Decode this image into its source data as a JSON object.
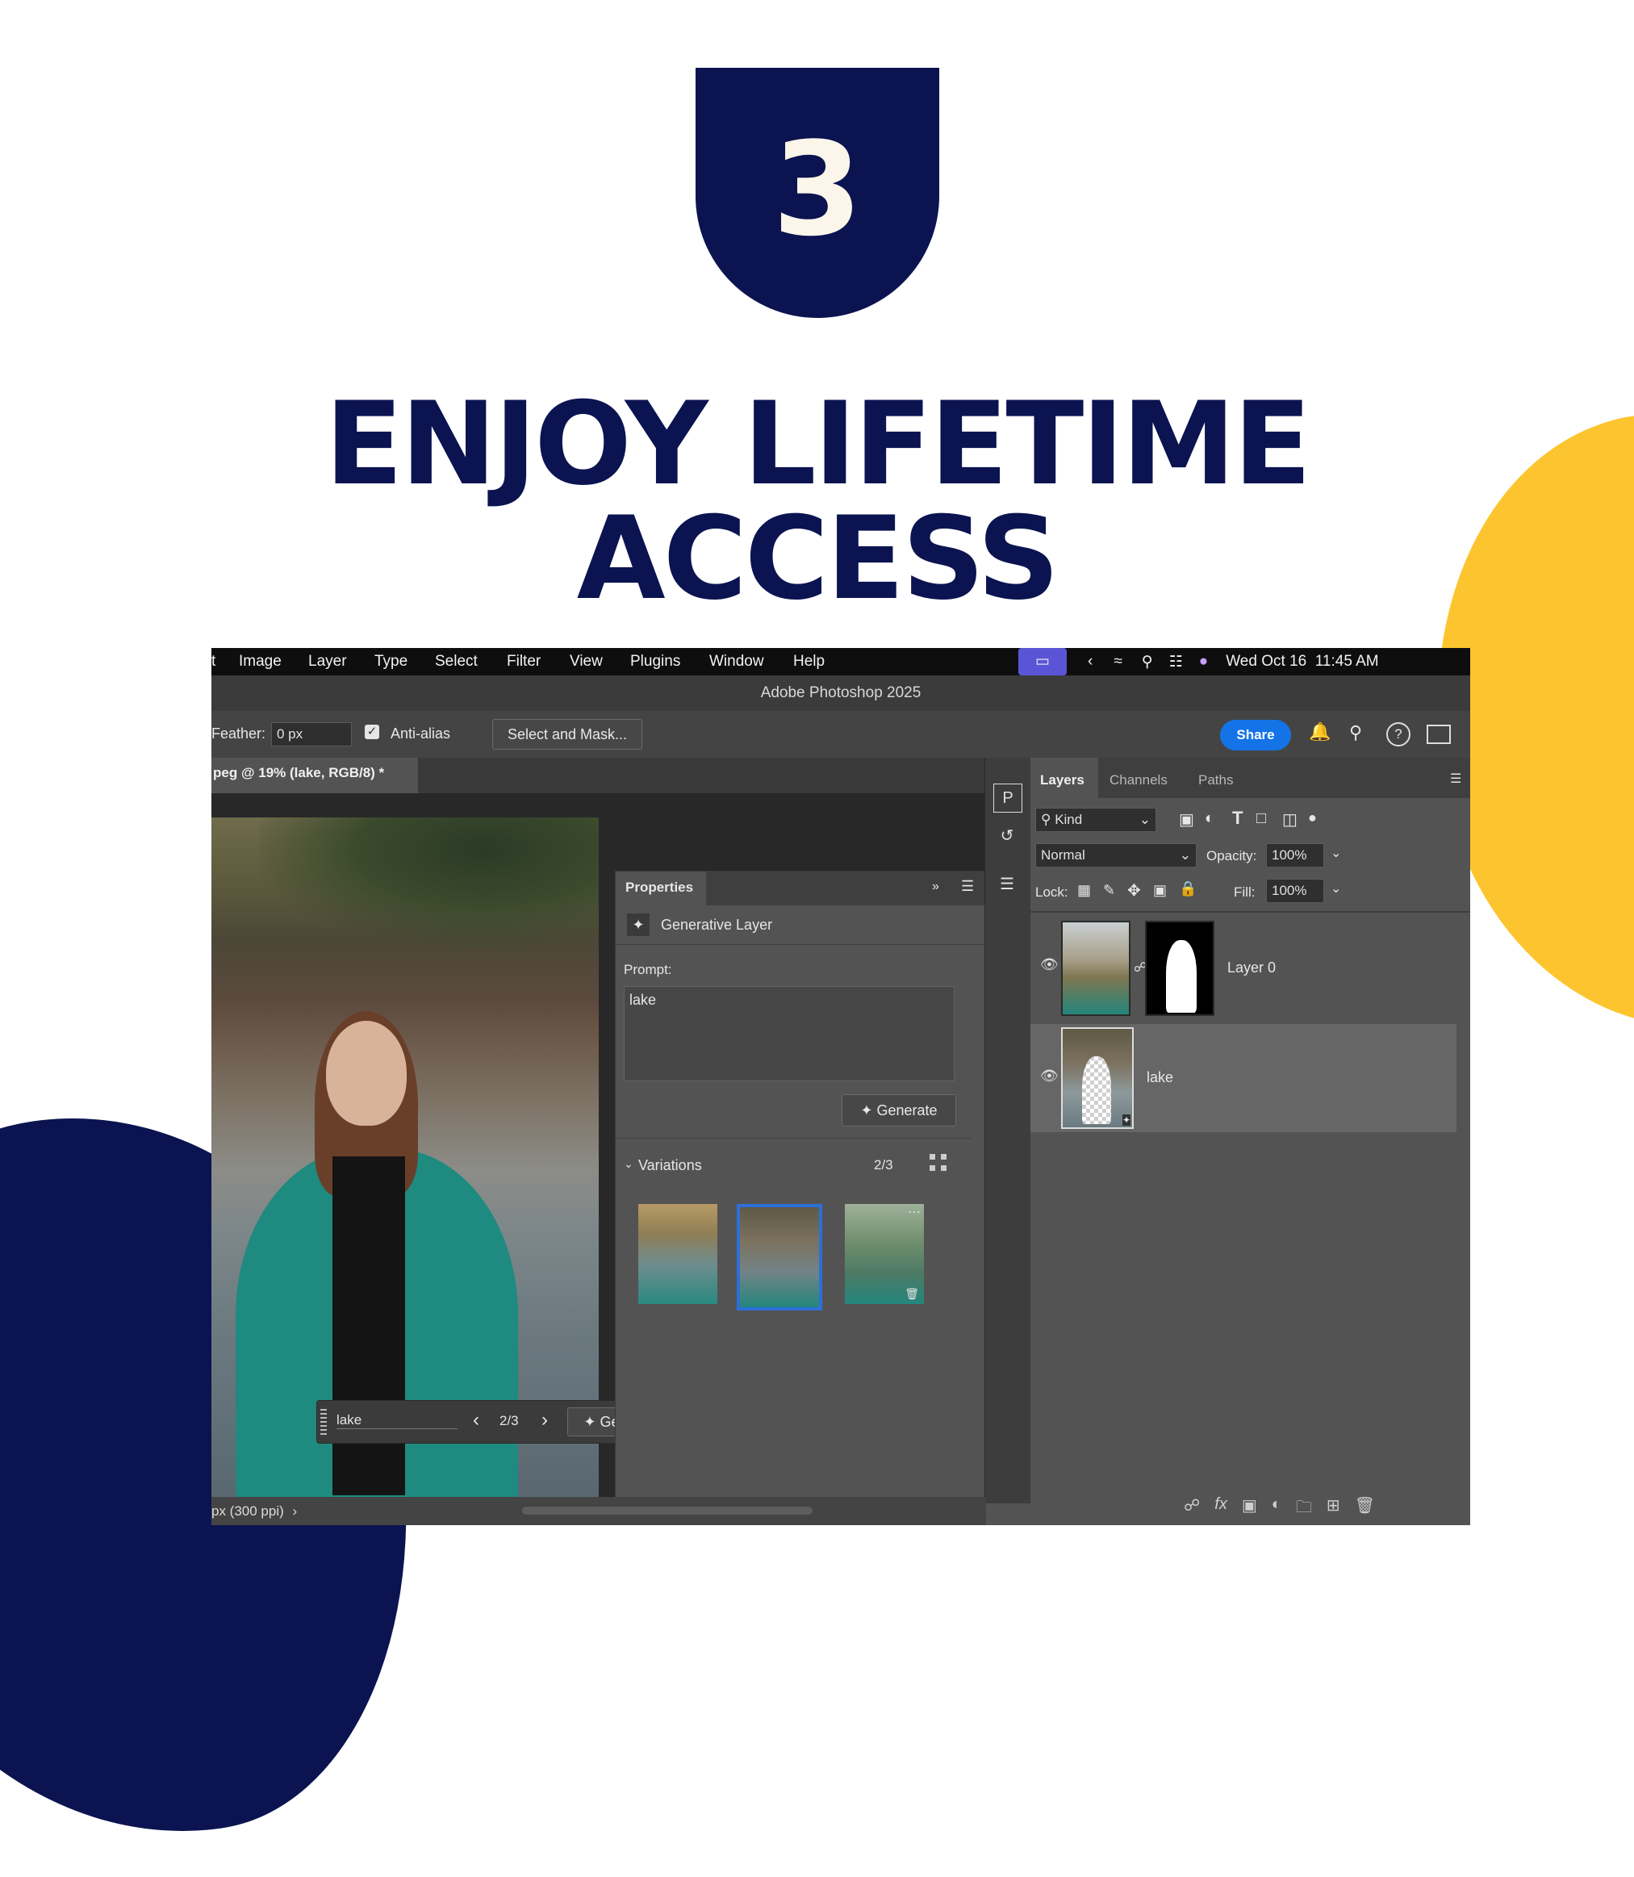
{
  "colors": {
    "navy": "#0b1450",
    "yellow": "#fcc52f",
    "cream": "#fbf5ea",
    "share_blue": "#1473e6"
  },
  "badge": {
    "number": "3"
  },
  "headline": {
    "line1": "ENJOY LIFETIME",
    "line2": "ACCESS"
  },
  "menubar": {
    "items": [
      "t",
      "Image",
      "Layer",
      "Type",
      "Select",
      "Filter",
      "View",
      "Plugins",
      "Window",
      "Help"
    ],
    "datetime": "Wed Oct 16  11:45 AM"
  },
  "app_title": "Adobe Photoshop 2025",
  "options": {
    "feather_label": "Feather:",
    "feather_value": "0 px",
    "antialias_label": "Anti-alias",
    "select_mask_label": "Select and Mask...",
    "share_label": "Share"
  },
  "document_tab": "peg @ 19% (lake, RGB/8) *",
  "status": {
    "text": "px (300 ppi)"
  },
  "floating_bar": {
    "prompt": "lake",
    "counter": "2/3",
    "generate_label": "Generate"
  },
  "properties": {
    "tab": "Properties",
    "layer_type": "Generative Layer",
    "prompt_label": "Prompt:",
    "prompt_value": "lake",
    "generate_label": "Generate",
    "variations_label": "Variations",
    "variations_count": "2/3",
    "selected_variation": 2
  },
  "layers_panel": {
    "tabs": [
      "Layers",
      "Channels",
      "Paths"
    ],
    "filter_kind": "Kind",
    "blend_mode": "Normal",
    "opacity_label": "Opacity:",
    "opacity_value": "100%",
    "lock_label": "Lock:",
    "fill_label": "Fill:",
    "fill_value": "100%",
    "layers": [
      {
        "name": "Layer 0",
        "visible": true,
        "selected": false
      },
      {
        "name": "lake",
        "visible": true,
        "selected": true
      }
    ]
  }
}
